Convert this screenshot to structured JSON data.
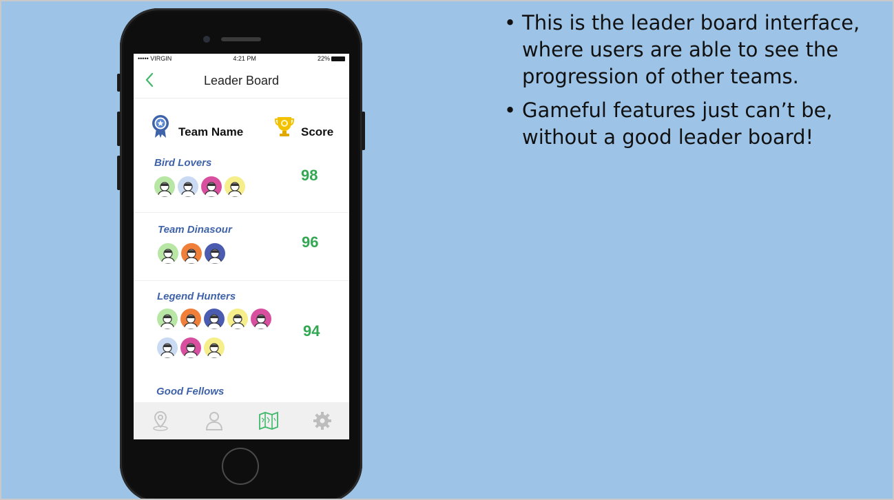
{
  "status_bar": {
    "carrier": "••••• VIRGIN",
    "time": "4:21 PM",
    "battery": "22%"
  },
  "nav": {
    "back_icon": "chevron-left-icon",
    "title": "Leader Board"
  },
  "header": {
    "team_col_label": "Team Name",
    "score_col_label": "Score",
    "team_icon": "ribbon-badge-icon",
    "score_icon": "trophy-icon"
  },
  "teams": [
    {
      "name": "Bird Lovers",
      "score": "98",
      "avatars": [
        "#b8e6a5",
        "#c9daf2",
        "#d94fa0",
        "#f5ee8a"
      ]
    },
    {
      "name": "Team Dinasour",
      "score": "96",
      "avatars": [
        "#b8e6a5",
        "#f07f3a",
        "#4a5bb0"
      ]
    },
    {
      "name": "Legend Hunters",
      "score": "94",
      "avatars": [
        "#b8e6a5",
        "#f07f3a",
        "#4a5bb0",
        "#f5ee8a",
        "#d94fa0",
        "#c9daf2",
        "#d94fa0",
        "#f5ee8a"
      ]
    },
    {
      "name": "Good Fellows",
      "score": "",
      "avatars": []
    }
  ],
  "tabs": [
    {
      "icon": "location-pin-icon",
      "active": false
    },
    {
      "icon": "user-icon",
      "active": false
    },
    {
      "icon": "map-icon",
      "active": true
    },
    {
      "icon": "gear-icon",
      "active": false
    }
  ],
  "colors": {
    "accent": "#33a853",
    "team_name": "#3f63a8",
    "slide_bg": "#9dc3e6"
  },
  "bullets": [
    "This is the leader board interface, where users are able to see the progression of other teams.",
    "Gameful features just can’t be, without a good leader board!"
  ],
  "bullet_glyph": "•"
}
